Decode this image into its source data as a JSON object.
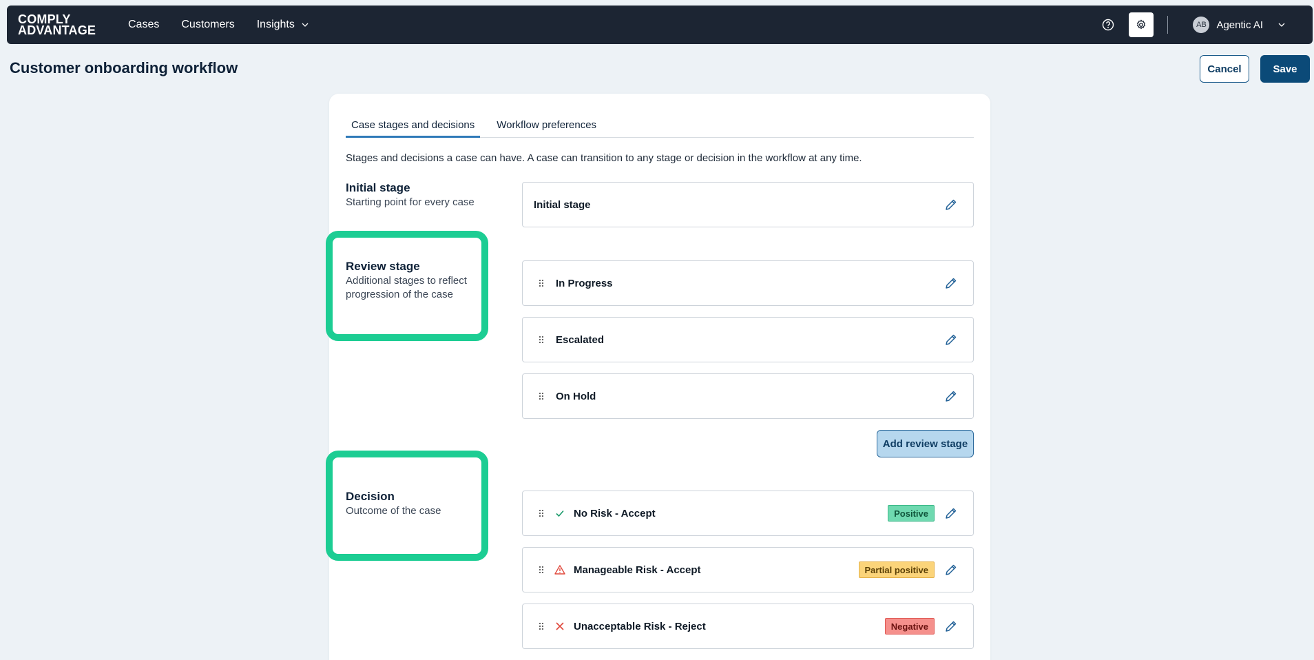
{
  "nav": {
    "logo_line1": "COMPLY",
    "logo_line2": "ADVANTAGE",
    "items": [
      "Cases",
      "Customers",
      "Insights"
    ],
    "user_initials": "AB",
    "user_name": "Agentic AI",
    "icons": [
      "help-circle-icon",
      "gear-icon",
      "chevron-down-icon"
    ]
  },
  "page": {
    "title": "Customer onboarding workflow",
    "cancel_label": "Cancel",
    "save_label": "Save"
  },
  "tabs": [
    "Case stages and decisions",
    "Workflow preferences"
  ],
  "description": "Stages and decisions a case can have. A case can transition to any stage or decision in the workflow at any time.",
  "initial_stage": {
    "title": "Initial stage",
    "subtitle": "Starting point for every case",
    "value": "Initial stage"
  },
  "review_stage": {
    "title": "Review stage",
    "subtitle": "Additional stages to reflect progression of the case",
    "items": [
      "In Progress",
      "Escalated",
      "On Hold"
    ],
    "add_label": "Add review stage"
  },
  "decision": {
    "title": "Decision",
    "subtitle": "Outcome of the case",
    "items": [
      {
        "label": "No Risk - Accept",
        "badge": "Positive",
        "icon": "check-icon",
        "badge_color": "#6fd9b0"
      },
      {
        "label": "Manageable Risk - Accept",
        "badge": "Partial positive",
        "icon": "warning-icon",
        "badge_color": "#fbd47a"
      },
      {
        "label": "Unacceptable Risk - Reject",
        "badge": "Negative",
        "icon": "x-icon",
        "badge_color": "#f5908c"
      }
    ]
  },
  "colors": {
    "nav_bg": "#1c2533",
    "primary": "#0b4a78",
    "highlight": "#1ccd93"
  }
}
